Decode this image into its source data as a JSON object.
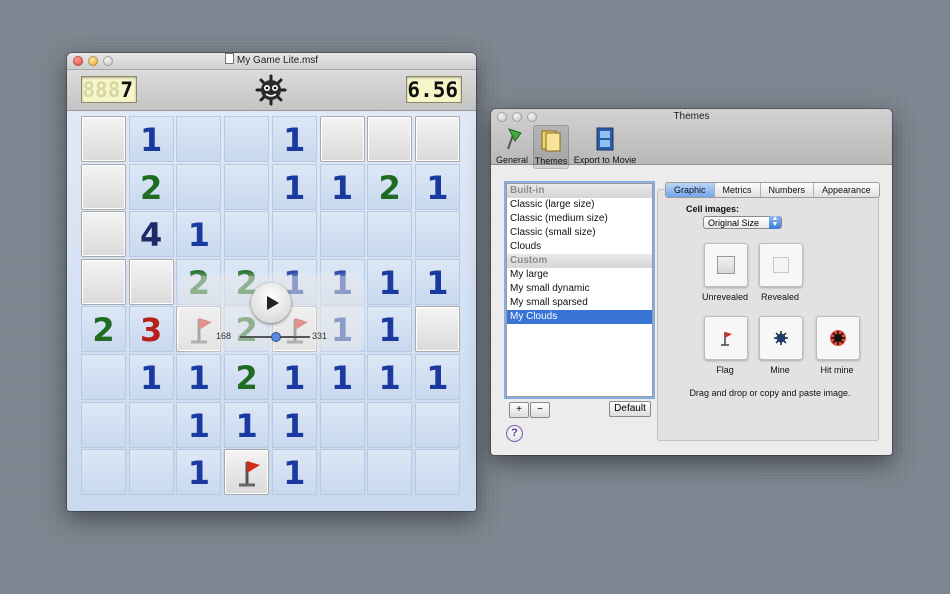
{
  "game_window": {
    "title": "My Game Lite.msf",
    "mines_left": "7",
    "mines_ghost": "888",
    "timer": "6.56",
    "smiley_icon": "mine-face-icon",
    "board": [
      [
        "c",
        "1",
        "o",
        "o",
        "1",
        "c",
        "c",
        "c"
      ],
      [
        "c",
        "2",
        "o",
        "o",
        "1",
        "1",
        "2",
        "1"
      ],
      [
        "c",
        "4",
        "1",
        "o",
        "o",
        "o",
        "o",
        "o"
      ],
      [
        "c",
        "c",
        "2",
        "2",
        "1",
        "1",
        "1",
        "1"
      ],
      [
        "2",
        "3",
        "F",
        "2",
        "F",
        "1",
        "1",
        "c"
      ],
      [
        "o",
        "1",
        "1",
        "2",
        "1",
        "1",
        "1",
        "1"
      ],
      [
        "o",
        "o",
        "1",
        "1",
        "1",
        "o",
        "o",
        "o"
      ],
      [
        "o",
        "o",
        "1",
        "F",
        "1",
        "o",
        "o",
        "o"
      ]
    ],
    "player": {
      "start": "168",
      "end": "331",
      "position": 0.5
    }
  },
  "themes_window": {
    "title": "Themes",
    "toolbar": [
      {
        "label": "General",
        "icon": "pin-icon"
      },
      {
        "label": "Themes",
        "icon": "themes-icon"
      },
      {
        "label": "Export to Movie",
        "icon": "film-icon"
      }
    ],
    "list": [
      {
        "label": "Built-in",
        "kind": "header"
      },
      {
        "label": "Classic (large size)",
        "kind": "item"
      },
      {
        "label": "Classic (medium size)",
        "kind": "item"
      },
      {
        "label": "Classic (small size)",
        "kind": "item"
      },
      {
        "label": "Clouds",
        "kind": "item"
      },
      {
        "label": "Custom",
        "kind": "header"
      },
      {
        "label": "My large",
        "kind": "item"
      },
      {
        "label": "My small dynamic",
        "kind": "item"
      },
      {
        "label": "My small sparsed",
        "kind": "item"
      },
      {
        "label": "My Clouds",
        "kind": "selected"
      }
    ],
    "add_label": "+",
    "remove_label": "−",
    "default_label": "Default",
    "help_label": "?",
    "tabs": [
      "Graphic",
      "Metrics",
      "Numbers",
      "Appearance"
    ],
    "cell_images_label": "Cell images:",
    "size_select": "Original Size",
    "wells": [
      "Unrevealed",
      "Revealed",
      "Flag",
      "Mine",
      "Hit mine"
    ],
    "hint": "Drag and drop or copy and paste image."
  }
}
